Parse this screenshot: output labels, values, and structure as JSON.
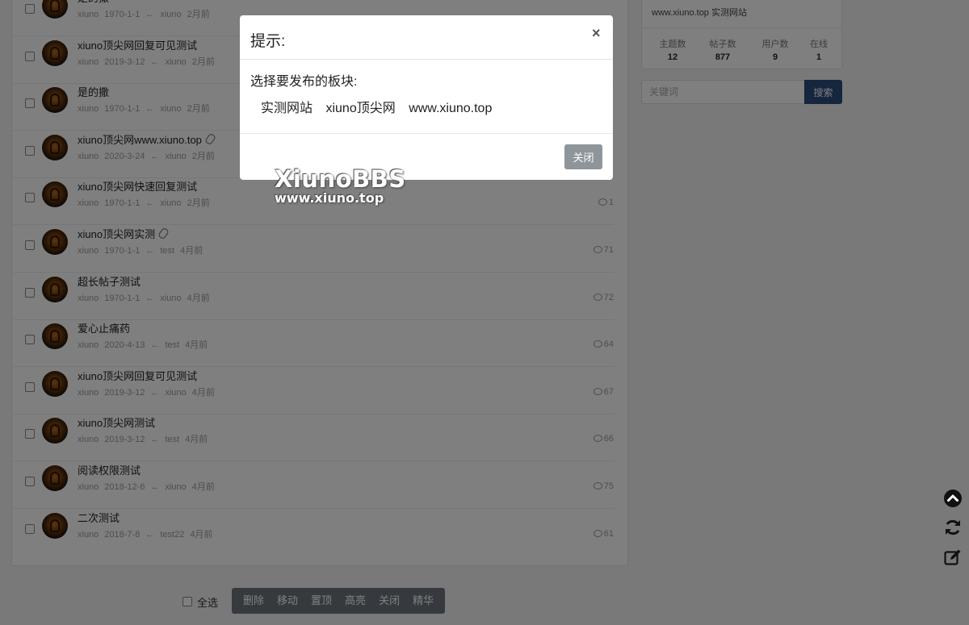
{
  "threads": [
    {
      "title": "是的撒",
      "author": "xiuno",
      "date": "1970-1-1",
      "arrow": "←",
      "last_user": "xiuno",
      "ago": "2月前",
      "replies": "",
      "attachment": false
    },
    {
      "title": "xiuno顶尖网回复可见测试",
      "author": "xiuno",
      "date": "2019-3-12",
      "arrow": "←",
      "last_user": "xiuno",
      "ago": "2月前",
      "replies": "",
      "attachment": false
    },
    {
      "title": "是的撒",
      "author": "xiuno",
      "date": "1970-1-1",
      "arrow": "←",
      "last_user": "xiuno",
      "ago": "2月前",
      "replies": "",
      "attachment": false
    },
    {
      "title": "xiuno顶尖网www.xiuno.top",
      "author": "xiuno",
      "date": "2020-3-24",
      "arrow": "←",
      "last_user": "xiuno",
      "ago": "2月前",
      "replies": "",
      "attachment": true
    },
    {
      "title": "xiuno顶尖网快速回复测试",
      "author": "xiuno",
      "date": "1970-1-1",
      "arrow": "←",
      "last_user": "xiuno",
      "ago": "2月前",
      "replies": "1",
      "attachment": false
    },
    {
      "title": "xiuno顶尖网实测",
      "author": "xiuno",
      "date": "1970-1-1",
      "arrow": "←",
      "last_user": "test",
      "ago": "4月前",
      "replies": "71",
      "attachment": true
    },
    {
      "title": "超长帖子测试",
      "author": "xiuno",
      "date": "1970-1-1",
      "arrow": "←",
      "last_user": "xiuno",
      "ago": "4月前",
      "replies": "72",
      "attachment": false
    },
    {
      "title": "爱心止痛药",
      "author": "xiuno",
      "date": "2020-4-13",
      "arrow": "←",
      "last_user": "test",
      "ago": "4月前",
      "replies": "64",
      "attachment": false
    },
    {
      "title": "xiuno顶尖网回复可见测试",
      "author": "xiuno",
      "date": "2019-3-12",
      "arrow": "←",
      "last_user": "xiuno",
      "ago": "4月前",
      "replies": "67",
      "attachment": false
    },
    {
      "title": "xiuno顶尖网测试",
      "author": "xiuno",
      "date": "2019-3-12",
      "arrow": "←",
      "last_user": "test",
      "ago": "4月前",
      "replies": "66",
      "attachment": false
    },
    {
      "title": "阅读权限测试",
      "author": "xiuno",
      "date": "2018-12-6",
      "arrow": "←",
      "last_user": "xiuno",
      "ago": "4月前",
      "replies": "75",
      "attachment": false
    },
    {
      "title": "二次测试",
      "author": "xiuno",
      "date": "2018-7-8",
      "arrow": "←",
      "last_user": "test22",
      "ago": "4月前",
      "replies": "61",
      "attachment": false
    }
  ],
  "toolbar": {
    "select_all": "全选",
    "buttons": [
      "删除",
      "移动",
      "置顶",
      "高亮",
      "关闭",
      "精华"
    ]
  },
  "sidebar": {
    "site_desc": "www.xiuno.top 实测网站",
    "stats": [
      {
        "label": "主题数",
        "value": "12"
      },
      {
        "label": "帖子数",
        "value": "877"
      },
      {
        "label": "用户数",
        "value": "9"
      },
      {
        "label": "在线",
        "value": "1"
      }
    ],
    "search_placeholder": "关键词",
    "search_button": "搜索"
  },
  "modal": {
    "title": "提示:",
    "close_symbol": "×",
    "prompt": "选择要发布的板块:",
    "forums": [
      "实测网站",
      "xiuno顶尖网",
      "www.xiuno.top"
    ],
    "close_button": "关闭"
  },
  "watermark": {
    "line1": "XiunoBBS",
    "line2": "www.xiuno.top"
  },
  "float_icons": [
    "chevron-up-circle-icon",
    "refresh-icon",
    "edit-icon"
  ]
}
